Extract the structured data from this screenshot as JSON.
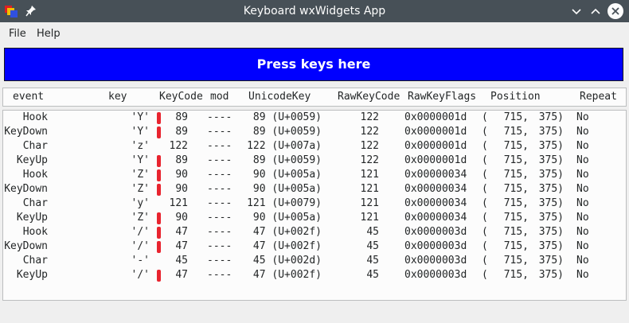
{
  "window": {
    "title": "Keyboard wxWidgets App"
  },
  "menu": {
    "items": [
      "File",
      "Help"
    ]
  },
  "press_button": {
    "label": "Press keys here",
    "color": "#0000ff"
  },
  "columns": [
    "event",
    "key",
    "KeyCode",
    "mod",
    "UnicodeKey",
    "RawKeyCode",
    "RawKeyFlags",
    "Position",
    "Repeat"
  ],
  "rows": [
    {
      "event": "Hook",
      "key": "'Y'",
      "keycode": "89",
      "mod": "----",
      "unicode": "89 (U+0059)",
      "rawcode": "122",
      "rawflags": "0x0000001d",
      "pos_x": "715,",
      "pos_y": "375)",
      "repeat": "No",
      "marked": true
    },
    {
      "event": "KeyDown",
      "key": "'Y'",
      "keycode": "89",
      "mod": "----",
      "unicode": "89 (U+0059)",
      "rawcode": "122",
      "rawflags": "0x0000001d",
      "pos_x": "715,",
      "pos_y": "375)",
      "repeat": "No",
      "marked": true
    },
    {
      "event": "Char",
      "key": "'z'",
      "keycode": "122",
      "mod": "----",
      "unicode": "122 (U+007a)",
      "rawcode": "122",
      "rawflags": "0x0000001d",
      "pos_x": "715,",
      "pos_y": "375)",
      "repeat": "No",
      "marked": false
    },
    {
      "event": "KeyUp",
      "key": "'Y'",
      "keycode": "89",
      "mod": "----",
      "unicode": "89 (U+0059)",
      "rawcode": "122",
      "rawflags": "0x0000001d",
      "pos_x": "715,",
      "pos_y": "375)",
      "repeat": "No",
      "marked": true
    },
    {
      "event": "Hook",
      "key": "'Z'",
      "keycode": "90",
      "mod": "----",
      "unicode": "90 (U+005a)",
      "rawcode": "121",
      "rawflags": "0x00000034",
      "pos_x": "715,",
      "pos_y": "375)",
      "repeat": "No",
      "marked": true
    },
    {
      "event": "KeyDown",
      "key": "'Z'",
      "keycode": "90",
      "mod": "----",
      "unicode": "90 (U+005a)",
      "rawcode": "121",
      "rawflags": "0x00000034",
      "pos_x": "715,",
      "pos_y": "375)",
      "repeat": "No",
      "marked": true
    },
    {
      "event": "Char",
      "key": "'y'",
      "keycode": "121",
      "mod": "----",
      "unicode": "121 (U+0079)",
      "rawcode": "121",
      "rawflags": "0x00000034",
      "pos_x": "715,",
      "pos_y": "375)",
      "repeat": "No",
      "marked": false
    },
    {
      "event": "KeyUp",
      "key": "'Z'",
      "keycode": "90",
      "mod": "----",
      "unicode": "90 (U+005a)",
      "rawcode": "121",
      "rawflags": "0x00000034",
      "pos_x": "715,",
      "pos_y": "375)",
      "repeat": "No",
      "marked": true
    },
    {
      "event": "Hook",
      "key": "'/'",
      "keycode": "47",
      "mod": "----",
      "unicode": "47 (U+002f)",
      "rawcode": "45",
      "rawflags": "0x0000003d",
      "pos_x": "715,",
      "pos_y": "375)",
      "repeat": "No",
      "marked": true
    },
    {
      "event": "KeyDown",
      "key": "'/'",
      "keycode": "47",
      "mod": "----",
      "unicode": "47 (U+002f)",
      "rawcode": "45",
      "rawflags": "0x0000003d",
      "pos_x": "715,",
      "pos_y": "375)",
      "repeat": "No",
      "marked": true
    },
    {
      "event": "Char",
      "key": "'-'",
      "keycode": "45",
      "mod": "----",
      "unicode": "45 (U+002d)",
      "rawcode": "45",
      "rawflags": "0x0000003d",
      "pos_x": "715,",
      "pos_y": "375)",
      "repeat": "No",
      "marked": false
    },
    {
      "event": "KeyUp",
      "key": "'/'",
      "keycode": "47",
      "mod": "----",
      "unicode": "47 (U+002f)",
      "rawcode": "45",
      "rawflags": "0x0000003d",
      "pos_x": "715,",
      "pos_y": "375)",
      "repeat": "No",
      "marked": true
    }
  ],
  "icons": {
    "app": "app-icon",
    "pin": "pin-icon",
    "minimize": "chevron-down-icon",
    "maximize": "chevron-up-icon",
    "close": "close-icon"
  },
  "colors": {
    "titlebar": "#475057",
    "marker": "#e8242f"
  }
}
